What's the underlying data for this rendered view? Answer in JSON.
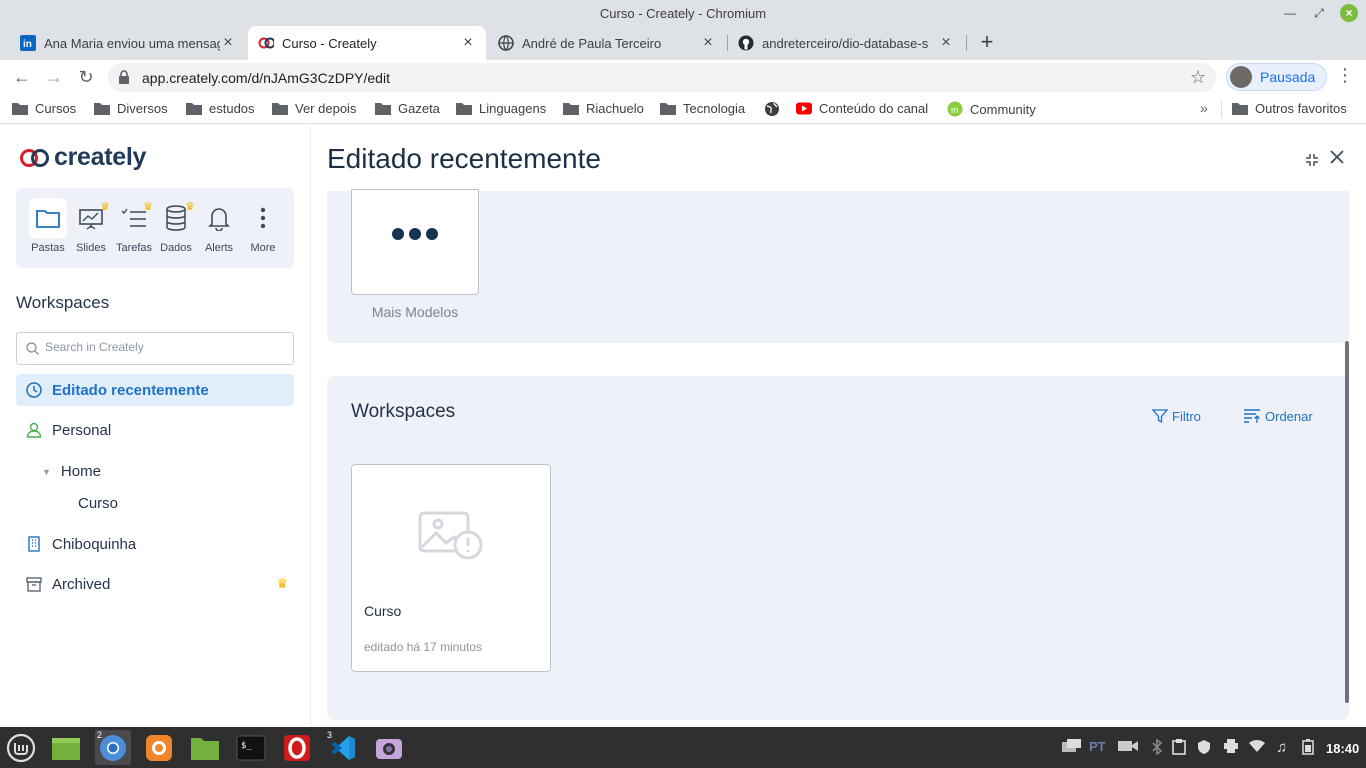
{
  "window": {
    "title": "Curso - Creately - Chromium"
  },
  "tabs": [
    {
      "label": "Ana Maria enviou uma mensag",
      "icon": "linkedin-icon"
    },
    {
      "label": "Curso - Creately",
      "icon": "creately-icon",
      "active": true
    },
    {
      "label": "André de Paula Terceiro",
      "icon": "globe-icon"
    },
    {
      "label": "andreterceiro/dio-database-s",
      "icon": "github-icon"
    }
  ],
  "toolbar": {
    "url": "app.creately.com/d/nJAmG3CzDPY/edit",
    "profile_label": "Pausada"
  },
  "bookmarks": {
    "items": [
      "Cursos",
      "Diversos",
      "estudos",
      "Ver depois",
      "Gazeta",
      "Linguagens",
      "Riachuelo",
      "Tecnologia",
      "",
      "Conteúdo do canal",
      "Community"
    ],
    "other": "Outros favoritos"
  },
  "app": {
    "logo_text": "creately",
    "quick": [
      "Pastas",
      "Slides",
      "Tarefas",
      "Dados",
      "Alerts",
      "More"
    ],
    "workspaces_heading": "Workspaces",
    "search_placeholder": "Search in Creately",
    "nav": {
      "recent": "Editado recentemente",
      "personal": "Personal",
      "home": "Home",
      "curso": "Curso",
      "chiboquinha": "Chiboquinha",
      "archived": "Archived"
    },
    "main": {
      "title": "Editado recentemente",
      "more_models": "Mais Modelos",
      "workspaces_title": "Workspaces",
      "filter": "Filtro",
      "sort": "Ordenar",
      "doc": {
        "title": "Curso",
        "meta": "editado há 17 minutos"
      }
    }
  },
  "taskbar": {
    "lang": "PT",
    "clock": "18:40",
    "badges": {
      "chromium": "2",
      "vscode": "3"
    }
  },
  "colors": {
    "accent": "#1f72c4",
    "crown": "#f5b400",
    "panel_bg": "#eef2f8",
    "taskbar": "#2f2f2f"
  }
}
